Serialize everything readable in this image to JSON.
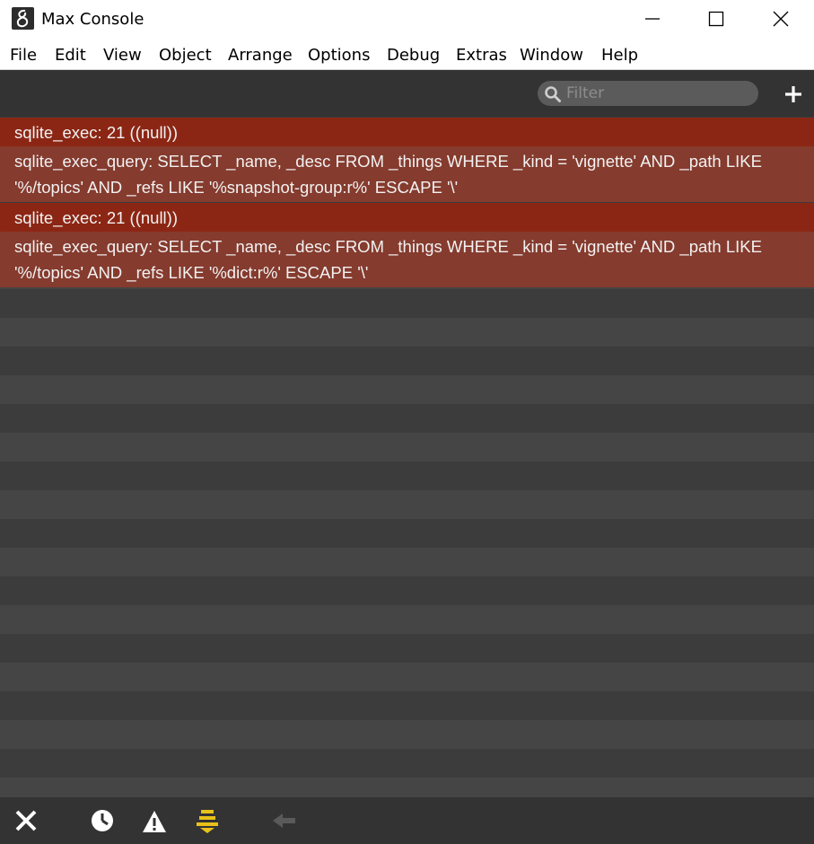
{
  "window": {
    "title": "Max Console"
  },
  "menu": [
    "File",
    "Edit",
    "View",
    "Object",
    "Arrange",
    "Options",
    "Debug",
    "Extras",
    "Window",
    "Help"
  ],
  "toolbar": {
    "filter_placeholder": "Filter",
    "filter_value": ""
  },
  "messages": [
    {
      "type": "exec",
      "lines": [
        "sqlite_exec: 21 ((null))"
      ]
    },
    {
      "type": "query",
      "lines": [
        "sqlite_exec_query: SELECT _name, _desc FROM _things WHERE _kind = 'vignette' AND _path LIKE",
        "'%/topics' AND _refs LIKE '%snapshot-group:r%' ESCAPE '\\'"
      ]
    },
    {
      "type": "exec",
      "lines": [
        "sqlite_exec: 21 ((null))"
      ]
    },
    {
      "type": "query",
      "lines": [
        "sqlite_exec_query: SELECT _name, _desc FROM _things WHERE _kind = 'vignette' AND _path LIKE",
        "'%/topics' AND _refs LIKE '%dict:r%' ESCAPE '\\'"
      ]
    }
  ],
  "colors": {
    "error_row": "#8c2614",
    "error_detail_row": "#853b2e",
    "console_stripe_a": "#3c3c3c",
    "console_stripe_b": "#454545",
    "toolbar_bg": "#333333",
    "accent_yellow": "#e8c21a"
  },
  "bottom_bar": {
    "icons": [
      "clear-icon",
      "clock-icon",
      "warning-icon",
      "autoscroll-icon",
      "back-arrow-icon"
    ]
  }
}
